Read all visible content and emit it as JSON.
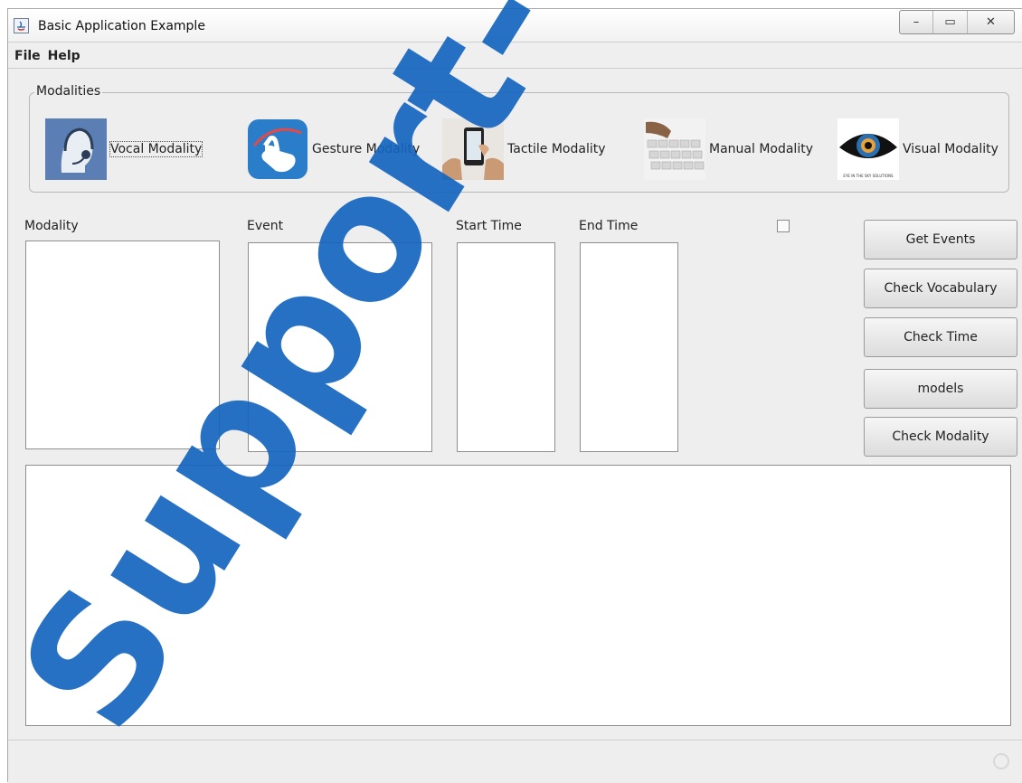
{
  "window": {
    "title": "Basic Application Example",
    "controls": {
      "minimize": "–",
      "maximize": "▭",
      "close": "✕"
    }
  },
  "menu": [
    "File",
    "Help"
  ],
  "modalities": {
    "legend": "Modalities",
    "items": [
      {
        "label": "Vocal Modality",
        "icon": "headset-operator-icon",
        "color": "#5b7fb4"
      },
      {
        "label": "Gesture Modality",
        "icon": "hand-swipe-icon",
        "color": "#2a7dc9"
      },
      {
        "label": "Tactile Modality",
        "icon": "smartphone-hands-icon",
        "color": "#c9a98e"
      },
      {
        "label": "Manual Modality",
        "icon": "keyboard-typing-icon",
        "color": "#bfbfbf"
      },
      {
        "label": "Visual Modality",
        "icon": "eye-icon",
        "color": "#1f1f1f"
      }
    ],
    "eye_caption": "EYE IN THE SKY SOLUTIONS"
  },
  "columns": {
    "modality": "Modality",
    "event": "Event",
    "start_time": "Start Time",
    "end_time": "End Time"
  },
  "checkbox": {
    "checked": false
  },
  "buttons": {
    "get_events": "Get Events",
    "check_vocabulary": "Check Vocabulary",
    "check_time": "Check Time",
    "models": "models",
    "check_modality": "Check Modality"
  },
  "watermark": {
    "text": "Support-Gratuit",
    "color": "#1565c0"
  }
}
